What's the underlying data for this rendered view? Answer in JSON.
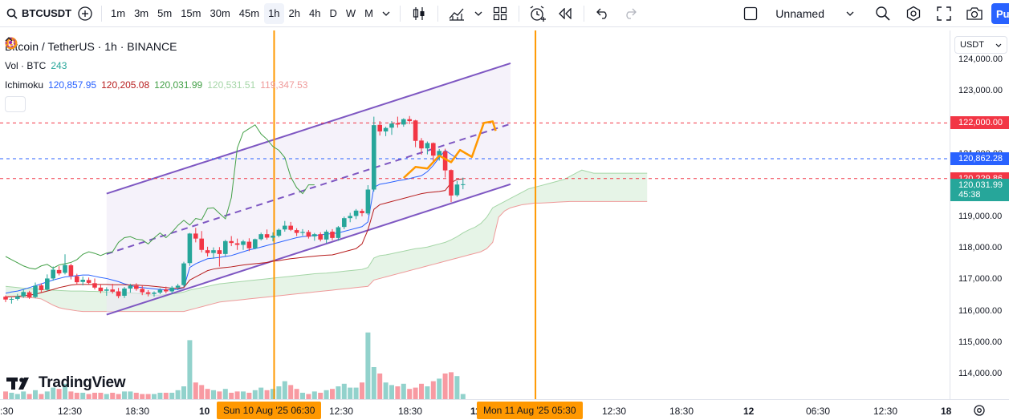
{
  "toolbar": {
    "symbol": "BTCUSDT",
    "intervals": [
      "1m",
      "3m",
      "5m",
      "15m",
      "30m",
      "45m",
      "1h",
      "2h",
      "4h",
      "D",
      "W",
      "M"
    ],
    "active_interval": "1h",
    "layout_name": "Unnamed",
    "publish_label": "Pu"
  },
  "legend": {
    "title": "Bitcoin / TetherUS · 1h · BINANCE",
    "volume_label": "Vol · BTC",
    "volume_value": "243",
    "ichimoku_label": "Ichimoku",
    "ichimoku_values": [
      {
        "value": "120,857.95",
        "color": "#2962ff"
      },
      {
        "value": "120,205.08",
        "color": "#b71c1c"
      },
      {
        "value": "120,031.99",
        "color": "#43a047"
      },
      {
        "value": "120,531.51",
        "color": "#a5d6a7"
      },
      {
        "value": "119,347.53",
        "color": "#ef9a9a"
      }
    ]
  },
  "watermark": "TradingView",
  "price_axis": {
    "currency": "USDT",
    "ticks": [
      "124,000.00",
      "123,000.00",
      "122,000.00",
      "121,000.00",
      "120,000.00",
      "119,000.00",
      "118,000.00",
      "117,000.00",
      "116,000.00",
      "115,000.00",
      "114,000.00"
    ],
    "labels": [
      {
        "text": "122,000.00",
        "color": "#f23645",
        "price": 122000
      },
      {
        "text": "120,862.28",
        "color": "#2962ff",
        "price": 120862.28
      },
      {
        "text": "120,229.86",
        "color": "#f23645",
        "price": 120229.86
      },
      {
        "text": "120,031.99",
        "color": "#26a69a",
        "price": 120031.99
      },
      {
        "text": "45:38",
        "color": "#26a69a",
        "price": 119710
      }
    ]
  },
  "time_axis": {
    "ticks": [
      ":30",
      "12:30",
      "18:30",
      "10",
      "12:30",
      "18:30",
      "11",
      "12:30",
      "18:30",
      "12",
      "06:30",
      "12:30",
      "18"
    ],
    "highlight_labels": [
      "Sun 10 Aug '25   06:30",
      "Mon 11 Aug '25   05:30"
    ]
  },
  "colors": {
    "up": "#26a69a",
    "down": "#f23645",
    "channel": "#7e57c2",
    "projection": "#ff9800",
    "tenkan": "#2962ff",
    "kijun": "#b71c1c",
    "chikou": "#43a047"
  },
  "chart_data": {
    "type": "candlestick",
    "symbol": "BTCUSDT",
    "timeframe": "1h",
    "ylim": [
      113600,
      124400
    ],
    "candles": [
      [
        116470,
        116510,
        116300,
        116380
      ],
      [
        116380,
        116450,
        116250,
        116400
      ],
      [
        116400,
        116560,
        116350,
        116480
      ],
      [
        116480,
        116700,
        116430,
        116620
      ],
      [
        116610,
        116660,
        116400,
        116450
      ],
      [
        116460,
        116920,
        116420,
        116820
      ],
      [
        116830,
        116890,
        116600,
        116680
      ],
      [
        116700,
        117180,
        116650,
        117050
      ],
      [
        117050,
        117430,
        116980,
        117330
      ],
      [
        117320,
        117440,
        117150,
        117210
      ],
      [
        117230,
        117820,
        117180,
        117480
      ],
      [
        117470,
        117520,
        117020,
        117130
      ],
      [
        117120,
        117200,
        116850,
        116930
      ],
      [
        116940,
        117110,
        116830,
        117010
      ],
      [
        117000,
        117080,
        116860,
        116910
      ],
      [
        116900,
        117050,
        116700,
        116760
      ],
      [
        116760,
        116860,
        116580,
        116650
      ],
      [
        116660,
        116770,
        116500,
        116700
      ],
      [
        116700,
        116880,
        116570,
        116630
      ],
      [
        116640,
        116750,
        116420,
        116490
      ],
      [
        116500,
        116780,
        116430,
        116730
      ],
      [
        116730,
        116880,
        116600,
        116820
      ],
      [
        116820,
        116900,
        116660,
        116720
      ],
      [
        116720,
        116830,
        116520,
        116610
      ],
      [
        116610,
        116680,
        116480,
        116560
      ],
      [
        116560,
        116640,
        116470,
        116600
      ],
      [
        116600,
        116740,
        116550,
        116690
      ],
      [
        116700,
        116790,
        116580,
        116640
      ],
      [
        116640,
        116810,
        116560,
        116760
      ],
      [
        116760,
        116880,
        116680,
        116820
      ],
      [
        116840,
        117580,
        116780,
        117530
      ],
      [
        117540,
        118500,
        117450,
        118480
      ],
      [
        118480,
        118660,
        118200,
        118320
      ],
      [
        118320,
        118560,
        117880,
        117960
      ],
      [
        117950,
        118060,
        117750,
        117860
      ],
      [
        117860,
        118040,
        117680,
        117950
      ],
      [
        117950,
        118050,
        117430,
        117830
      ],
      [
        117830,
        118280,
        117760,
        118240
      ],
      [
        118240,
        118400,
        118080,
        118180
      ],
      [
        118170,
        118320,
        117960,
        118120
      ],
      [
        118120,
        118280,
        117960,
        118230
      ],
      [
        118220,
        118330,
        117920,
        118010
      ],
      [
        118010,
        118320,
        117980,
        118300
      ],
      [
        118300,
        118510,
        118260,
        118460
      ],
      [
        118460,
        118610,
        118290,
        118350
      ],
      [
        118350,
        118520,
        118230,
        118410
      ],
      [
        118410,
        118640,
        118360,
        118600
      ],
      [
        118610,
        118880,
        118540,
        118730
      ],
      [
        118730,
        118850,
        118560,
        118600
      ],
      [
        118590,
        118650,
        118400,
        118500
      ],
      [
        118500,
        118620,
        118410,
        118530
      ],
      [
        118530,
        118590,
        118320,
        118380
      ],
      [
        118390,
        118500,
        118250,
        118460
      ],
      [
        118460,
        118520,
        118230,
        118290
      ],
      [
        118290,
        118600,
        118180,
        118540
      ],
      [
        118540,
        118620,
        118270,
        118340
      ],
      [
        118340,
        118720,
        118250,
        118680
      ],
      [
        118690,
        119020,
        118620,
        118970
      ],
      [
        118970,
        119140,
        118840,
        119040
      ],
      [
        119040,
        119260,
        118940,
        119210
      ],
      [
        119200,
        119260,
        119030,
        119130
      ],
      [
        119120,
        120020,
        119070,
        119880
      ],
      [
        119880,
        122200,
        119820,
        121930
      ],
      [
        121940,
        122060,
        121600,
        121730
      ],
      [
        121730,
        121880,
        121580,
        121840
      ],
      [
        121850,
        122060,
        121620,
        121980
      ],
      [
        121990,
        122200,
        121850,
        121950
      ],
      [
        121950,
        122150,
        121880,
        122120
      ],
      [
        122120,
        122220,
        121960,
        122060
      ],
      [
        122080,
        122100,
        121230,
        121430
      ],
      [
        121440,
        121520,
        120990,
        121190
      ],
      [
        121190,
        121410,
        121000,
        121360
      ],
      [
        121360,
        121380,
        120770,
        120960
      ],
      [
        120960,
        121170,
        120800,
        121110
      ],
      [
        121100,
        121180,
        120260,
        120490
      ],
      [
        120500,
        120520,
        119480,
        119690
      ],
      [
        119700,
        120150,
        119650,
        120040
      ],
      [
        120030,
        120260,
        119890,
        120050
      ]
    ],
    "volume": [
      6,
      5,
      4,
      6,
      4,
      7,
      4,
      6,
      9,
      8,
      12,
      6,
      5,
      5,
      4,
      5,
      5,
      4,
      5,
      4,
      6,
      6,
      5,
      4,
      4,
      4,
      5,
      5,
      5,
      7,
      10,
      46,
      13,
      11,
      8,
      7,
      6,
      8,
      5,
      6,
      6,
      5,
      7,
      9,
      7,
      8,
      10,
      14,
      11,
      8,
      5,
      4,
      6,
      5,
      7,
      8,
      10,
      12,
      9,
      9,
      13,
      52,
      25,
      20,
      13,
      11,
      10,
      12,
      8,
      9,
      12,
      10,
      14,
      16,
      20,
      21,
      18,
      4
    ],
    "volume_up_color": "#26a69a",
    "volume_down_color": "#f23645",
    "horizontal_lines": [
      {
        "price": 122000,
        "color": "#f23645",
        "style": "dashed"
      },
      {
        "price": 120862.28,
        "color": "#2962ff",
        "style": "dashed"
      },
      {
        "price": 120229.86,
        "color": "#f23645",
        "style": "dashed"
      }
    ],
    "channel": {
      "upper": {
        "from": [
          17,
          119750
        ],
        "to": [
          85,
          123900
        ]
      },
      "lower": {
        "from": [
          17,
          115900
        ],
        "to": [
          85,
          120050
        ]
      },
      "mid": {
        "from": [
          17,
          117830
        ],
        "to": [
          85,
          121970
        ]
      }
    },
    "projection_path": [
      [
        67,
        120250
      ],
      [
        69,
        120600
      ],
      [
        71,
        120550
      ],
      [
        73,
        120960
      ],
      [
        75,
        120750
      ],
      [
        76.5,
        121140
      ],
      [
        78.5,
        120920
      ],
      [
        80.5,
        122000
      ],
      [
        82,
        122050
      ],
      [
        82.5,
        121750
      ]
    ],
    "highlighted_times": [
      "Sun 10 Aug '25 06:30",
      "Mon 11 Aug '25 05:30"
    ],
    "ichimoku": {
      "tenkan": [
        116580,
        116620,
        116650,
        116700,
        116760,
        116820,
        116880,
        116940,
        117000,
        117050,
        117100,
        117120,
        117140,
        117160,
        117160,
        117120,
        117080,
        117050,
        117000,
        116950,
        116880,
        116830,
        116780,
        116760,
        116740,
        116720,
        116700,
        116690,
        116690,
        116700,
        116760,
        117400,
        117520,
        117600,
        117680,
        117700,
        117720,
        117750,
        117780,
        117840,
        117900,
        117960,
        118000,
        118050,
        118100,
        118150,
        118200,
        118250,
        118300,
        118350,
        118380,
        118400,
        118420,
        118440,
        118460,
        118480,
        118500,
        118550,
        118600,
        118650,
        118700,
        118850,
        119950,
        120050,
        120080,
        120120,
        120160,
        120190,
        120230,
        120280,
        120320,
        120450,
        120650,
        120900,
        121130,
        121000,
        120870,
        120860
      ],
      "kijun": [
        116460,
        116470,
        116480,
        116500,
        116520,
        116550,
        116600,
        116650,
        116700,
        116760,
        116800,
        116840,
        116860,
        116860,
        116860,
        116860,
        116860,
        116860,
        116850,
        116850,
        116850,
        116840,
        116840,
        116830,
        116820,
        116800,
        116780,
        116760,
        116740,
        116740,
        116760,
        117000,
        117100,
        117200,
        117300,
        117350,
        117380,
        117400,
        117420,
        117450,
        117480,
        117500,
        117520,
        117540,
        117560,
        117600,
        117620,
        117650,
        117680,
        117700,
        117720,
        117740,
        117760,
        117780,
        117790,
        117800,
        117850,
        117900,
        117950,
        118000,
        118150,
        118600,
        119250,
        119400,
        119450,
        119500,
        119550,
        119600,
        119650,
        119700,
        119750,
        119780,
        119800,
        119820,
        119850,
        120100,
        120200,
        120220
      ],
      "chikou": [
        {
          "start": 0,
          "values": [
            117750,
            117650,
            117550,
            117450,
            117380,
            117350,
            117450,
            117500,
            117380,
            117480,
            117520,
            117560,
            117650,
            117820,
            117900,
            117850,
            117780,
            117860,
            117900,
            118200,
            118350,
            118380,
            118300,
            118280,
            118150,
            118340,
            118500,
            118350,
            118520,
            118740,
            118900,
            118750,
            118960,
            118920,
            119280,
            119300,
            119120,
            118950,
            119620,
            121200,
            121700,
            121820,
            121940,
            121650,
            121480,
            121250,
            121130,
            120900,
            120280,
            119940,
            119750,
            120030,
            120030
          ]
        }
      ],
      "span_a": [
        116800,
        116780,
        116760,
        116740,
        116730,
        116720,
        116700,
        116690,
        116680,
        116670,
        116660,
        116650,
        116650,
        116650,
        116640,
        116640,
        116630,
        116620,
        116620,
        116610,
        116600,
        116590,
        116580,
        116560,
        116540,
        116520,
        116520,
        116540,
        116560,
        116580,
        116620,
        116680,
        116720,
        116760,
        116800,
        116840,
        116880,
        116900,
        116920,
        116940,
        116960,
        116980,
        117000,
        117020,
        117040,
        117060,
        117080,
        117100,
        117120,
        117140,
        117160,
        117180,
        117200,
        117210,
        117220,
        117240,
        117260,
        117280,
        117300,
        117320,
        117340,
        117400,
        117700,
        117780,
        117800,
        117840,
        117880,
        117920,
        117960,
        118000,
        118020,
        118050,
        118100,
        118150,
        118200,
        118280,
        118380,
        118500,
        118600,
        118680,
        118800,
        119000,
        119300,
        119400,
        119500,
        119600,
        119700,
        119800,
        119900,
        119950,
        120000,
        120050,
        120100,
        120150,
        120200,
        120300,
        120400,
        120500,
        120450,
        120400,
        120400,
        120400,
        120400,
        120400,
        120400,
        120400,
        120400,
        120400,
        120400
      ],
      "span_b": [
        116480,
        116470,
        116460,
        116450,
        116440,
        116430,
        116400,
        116300,
        116200,
        116120,
        116080,
        116050,
        116020,
        116000,
        116000,
        116000,
        116000,
        116000,
        116000,
        116000,
        116000,
        116000,
        116000,
        116000,
        116000,
        116000,
        116000,
        116000,
        116000,
        116000,
        116000,
        116050,
        116100,
        116150,
        116200,
        116250,
        116300,
        116320,
        116340,
        116360,
        116380,
        116400,
        116420,
        116440,
        116460,
        116480,
        116500,
        116520,
        116540,
        116560,
        116580,
        116600,
        116620,
        116640,
        116660,
        116680,
        116700,
        116720,
        116740,
        116760,
        116780,
        116800,
        117000,
        117050,
        117100,
        117150,
        117200,
        117250,
        117300,
        117350,
        117400,
        117450,
        117500,
        117550,
        117600,
        117650,
        117700,
        117750,
        117800,
        117850,
        117900,
        118000,
        118200,
        119000,
        119200,
        119300,
        119350,
        119400,
        119420,
        119450,
        119450,
        119460,
        119470,
        119480,
        119490,
        119500,
        119500,
        119500,
        119500,
        119500,
        119500,
        119500,
        119500,
        119500,
        119500,
        119500,
        119500,
        119500,
        119500
      ]
    }
  }
}
